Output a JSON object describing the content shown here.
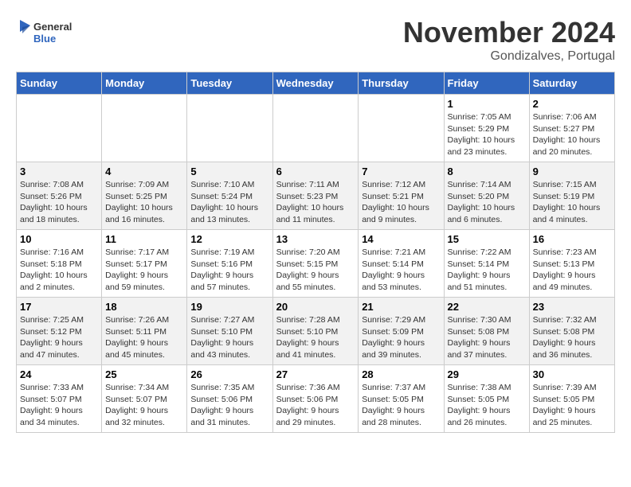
{
  "logo": {
    "line1": "General",
    "line2": "Blue"
  },
  "title": "November 2024",
  "location": "Gondizalves, Portugal",
  "headers": [
    "Sunday",
    "Monday",
    "Tuesday",
    "Wednesday",
    "Thursday",
    "Friday",
    "Saturday"
  ],
  "weeks": [
    [
      {
        "day": "",
        "info": ""
      },
      {
        "day": "",
        "info": ""
      },
      {
        "day": "",
        "info": ""
      },
      {
        "day": "",
        "info": ""
      },
      {
        "day": "",
        "info": ""
      },
      {
        "day": "1",
        "info": "Sunrise: 7:05 AM\nSunset: 5:29 PM\nDaylight: 10 hours and 23 minutes."
      },
      {
        "day": "2",
        "info": "Sunrise: 7:06 AM\nSunset: 5:27 PM\nDaylight: 10 hours and 20 minutes."
      }
    ],
    [
      {
        "day": "3",
        "info": "Sunrise: 7:08 AM\nSunset: 5:26 PM\nDaylight: 10 hours and 18 minutes."
      },
      {
        "day": "4",
        "info": "Sunrise: 7:09 AM\nSunset: 5:25 PM\nDaylight: 10 hours and 16 minutes."
      },
      {
        "day": "5",
        "info": "Sunrise: 7:10 AM\nSunset: 5:24 PM\nDaylight: 10 hours and 13 minutes."
      },
      {
        "day": "6",
        "info": "Sunrise: 7:11 AM\nSunset: 5:23 PM\nDaylight: 10 hours and 11 minutes."
      },
      {
        "day": "7",
        "info": "Sunrise: 7:12 AM\nSunset: 5:21 PM\nDaylight: 10 hours and 9 minutes."
      },
      {
        "day": "8",
        "info": "Sunrise: 7:14 AM\nSunset: 5:20 PM\nDaylight: 10 hours and 6 minutes."
      },
      {
        "day": "9",
        "info": "Sunrise: 7:15 AM\nSunset: 5:19 PM\nDaylight: 10 hours and 4 minutes."
      }
    ],
    [
      {
        "day": "10",
        "info": "Sunrise: 7:16 AM\nSunset: 5:18 PM\nDaylight: 10 hours and 2 minutes."
      },
      {
        "day": "11",
        "info": "Sunrise: 7:17 AM\nSunset: 5:17 PM\nDaylight: 9 hours and 59 minutes."
      },
      {
        "day": "12",
        "info": "Sunrise: 7:19 AM\nSunset: 5:16 PM\nDaylight: 9 hours and 57 minutes."
      },
      {
        "day": "13",
        "info": "Sunrise: 7:20 AM\nSunset: 5:15 PM\nDaylight: 9 hours and 55 minutes."
      },
      {
        "day": "14",
        "info": "Sunrise: 7:21 AM\nSunset: 5:14 PM\nDaylight: 9 hours and 53 minutes."
      },
      {
        "day": "15",
        "info": "Sunrise: 7:22 AM\nSunset: 5:14 PM\nDaylight: 9 hours and 51 minutes."
      },
      {
        "day": "16",
        "info": "Sunrise: 7:23 AM\nSunset: 5:13 PM\nDaylight: 9 hours and 49 minutes."
      }
    ],
    [
      {
        "day": "17",
        "info": "Sunrise: 7:25 AM\nSunset: 5:12 PM\nDaylight: 9 hours and 47 minutes."
      },
      {
        "day": "18",
        "info": "Sunrise: 7:26 AM\nSunset: 5:11 PM\nDaylight: 9 hours and 45 minutes."
      },
      {
        "day": "19",
        "info": "Sunrise: 7:27 AM\nSunset: 5:10 PM\nDaylight: 9 hours and 43 minutes."
      },
      {
        "day": "20",
        "info": "Sunrise: 7:28 AM\nSunset: 5:10 PM\nDaylight: 9 hours and 41 minutes."
      },
      {
        "day": "21",
        "info": "Sunrise: 7:29 AM\nSunset: 5:09 PM\nDaylight: 9 hours and 39 minutes."
      },
      {
        "day": "22",
        "info": "Sunrise: 7:30 AM\nSunset: 5:08 PM\nDaylight: 9 hours and 37 minutes."
      },
      {
        "day": "23",
        "info": "Sunrise: 7:32 AM\nSunset: 5:08 PM\nDaylight: 9 hours and 36 minutes."
      }
    ],
    [
      {
        "day": "24",
        "info": "Sunrise: 7:33 AM\nSunset: 5:07 PM\nDaylight: 9 hours and 34 minutes."
      },
      {
        "day": "25",
        "info": "Sunrise: 7:34 AM\nSunset: 5:07 PM\nDaylight: 9 hours and 32 minutes."
      },
      {
        "day": "26",
        "info": "Sunrise: 7:35 AM\nSunset: 5:06 PM\nDaylight: 9 hours and 31 minutes."
      },
      {
        "day": "27",
        "info": "Sunrise: 7:36 AM\nSunset: 5:06 PM\nDaylight: 9 hours and 29 minutes."
      },
      {
        "day": "28",
        "info": "Sunrise: 7:37 AM\nSunset: 5:05 PM\nDaylight: 9 hours and 28 minutes."
      },
      {
        "day": "29",
        "info": "Sunrise: 7:38 AM\nSunset: 5:05 PM\nDaylight: 9 hours and 26 minutes."
      },
      {
        "day": "30",
        "info": "Sunrise: 7:39 AM\nSunset: 5:05 PM\nDaylight: 9 hours and 25 minutes."
      }
    ]
  ]
}
